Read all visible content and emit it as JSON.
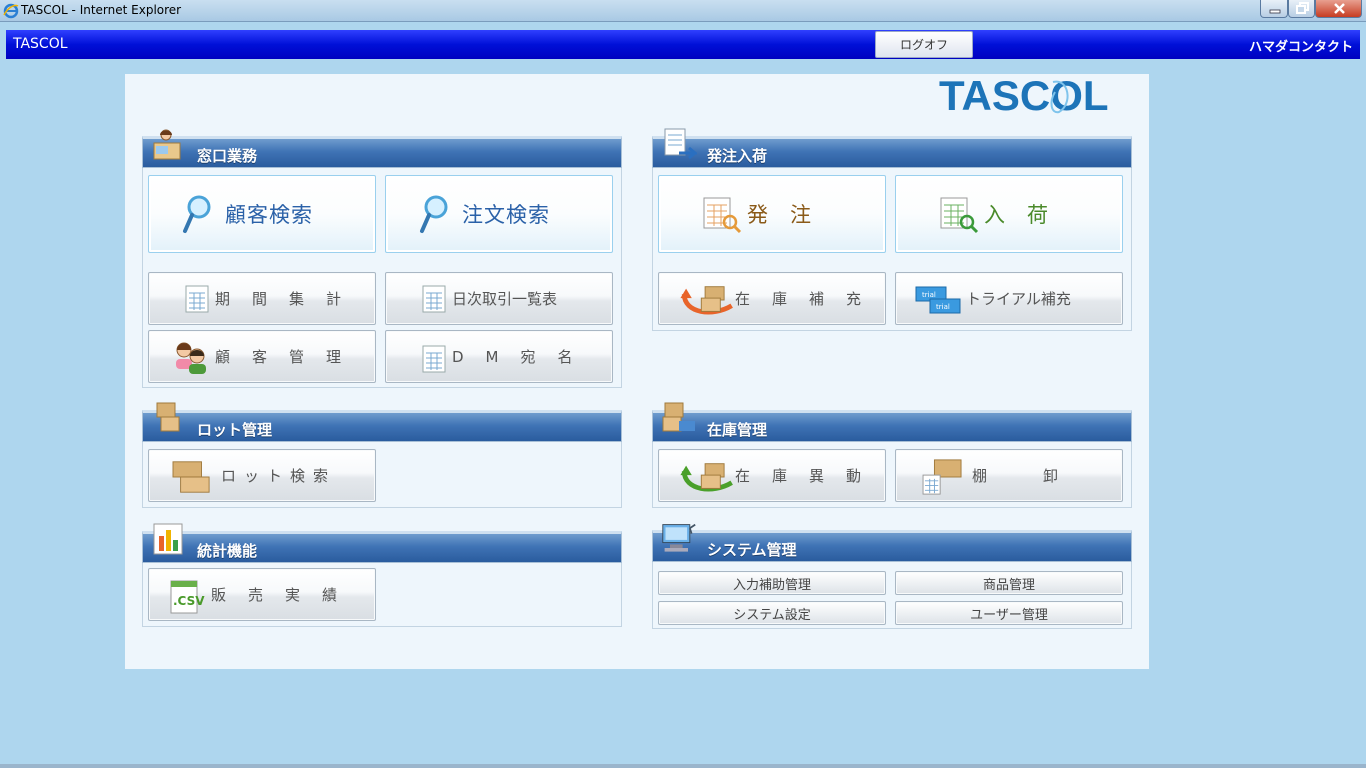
{
  "window": {
    "title": "TASCOL - Internet Explorer"
  },
  "header": {
    "app_name": "TASCOL",
    "logoff_label": "ログオフ",
    "user_name": "ハマダコンタクト"
  },
  "logo_text": "TASCOL",
  "sections": {
    "window_ops": {
      "title": "窓口業務",
      "customer_search": "顧客検索",
      "order_search": "注文検索",
      "period_summary": "期間集計",
      "daily_list": "日次取引一覧表",
      "customer_mgmt": "顧客管理",
      "dm_address": "DM宛名"
    },
    "ordering": {
      "title": "発注入荷",
      "order": "発注",
      "receive": "入荷",
      "restock": "在庫補充",
      "trial_restock": "トライアル補充"
    },
    "lot": {
      "title": "ロット管理",
      "lot_search": "ロット検索"
    },
    "inventory": {
      "title": "在庫管理",
      "stock_move": "在庫異動",
      "stocktake": "棚卸"
    },
    "stats": {
      "title": "統計機能",
      "sales": "販売実績"
    },
    "system": {
      "title": "システム管理",
      "input_assist": "入力補助管理",
      "product_mgmt": "商品管理",
      "system_settings": "システム設定",
      "user_mgmt": "ユーザー管理"
    }
  },
  "colors": {
    "header_blue": "#0010d8",
    "section_blue": "#3f73b5",
    "background": "#aed6ee",
    "panel": "#eef6fc"
  }
}
